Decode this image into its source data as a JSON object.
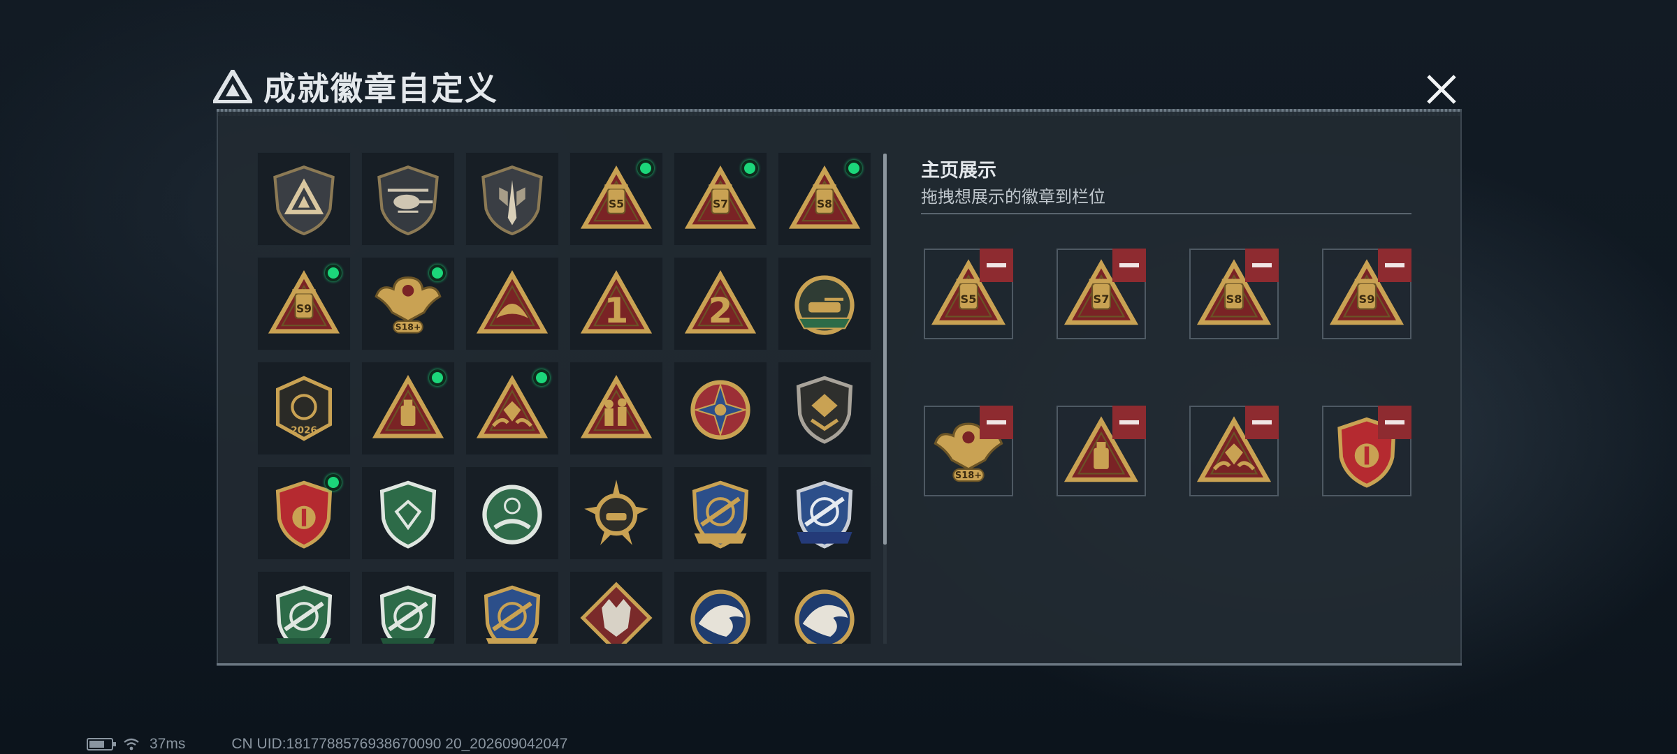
{
  "window": {
    "title": "成就徽章自定义",
    "close_label": "close"
  },
  "showcase": {
    "title": "主页展示",
    "subtitle": "拖拽想展示的徽章到栏位"
  },
  "badges": [
    {
      "icon": "delta-shield-icon",
      "equipped": false
    },
    {
      "icon": "helicopter-shield-icon",
      "equipped": false
    },
    {
      "icon": "dagger-shield-icon",
      "equipped": false
    },
    {
      "icon": "s5-season-badge-icon",
      "label": "S5",
      "equipped": true
    },
    {
      "icon": "s7-season-badge-icon",
      "label": "S7",
      "equipped": true
    },
    {
      "icon": "s8-season-badge-icon",
      "label": "S8",
      "equipped": true
    },
    {
      "icon": "s9-season-badge-icon",
      "label": "S9",
      "equipped": true
    },
    {
      "icon": "s18-eagle-badge-icon",
      "label": "S18+",
      "equipped": true
    },
    {
      "icon": "bird-triangle-badge-icon",
      "equipped": false
    },
    {
      "icon": "rank-1-badge-icon",
      "label": "1",
      "equipped": false
    },
    {
      "icon": "rank-2-badge-icon",
      "label": "2",
      "equipped": false
    },
    {
      "icon": "delta-force-tank-badge-icon",
      "equipped": false
    },
    {
      "icon": "delta-force-2026-badge-icon",
      "label": "2026",
      "equipped": false
    },
    {
      "icon": "usb-triangle-badge-icon",
      "equipped": true
    },
    {
      "icon": "gem-hands-badge-icon",
      "equipped": true
    },
    {
      "icon": "soldiers-triangle-badge-icon",
      "equipped": false
    },
    {
      "icon": "star-compass-badge-icon",
      "equipped": false
    },
    {
      "icon": "chevron-shield-badge-icon",
      "equipped": false
    },
    {
      "icon": "crest-shield-badge-icon",
      "equipped": true
    },
    {
      "icon": "green-gem-shield-badge-icon",
      "equipped": false
    },
    {
      "icon": "green-target-badge-icon",
      "equipped": false
    },
    {
      "icon": "tank-star-badge-icon",
      "equipped": false
    },
    {
      "icon": "gold-rifle-shield-badge-icon",
      "equipped": false
    },
    {
      "icon": "blue-rifle-shield-badge-icon",
      "equipped": false
    },
    {
      "icon": "green-rifle-shield-badge-icon",
      "equipped": false
    },
    {
      "icon": "green-rifle-shield-2-badge-icon",
      "equipped": false
    },
    {
      "icon": "gold-rifle-shield-2-badge-icon",
      "equipped": false
    },
    {
      "icon": "wolf-diamond-badge-icon",
      "equipped": false
    },
    {
      "icon": "eagle-blue-badge-icon",
      "equipped": false
    },
    {
      "icon": "eagle-blue-2-badge-icon",
      "equipped": false
    }
  ],
  "slots": [
    {
      "icon": "s5-season-badge-icon",
      "label": "S5"
    },
    {
      "icon": "s7-season-badge-icon",
      "label": "S7"
    },
    {
      "icon": "s8-season-badge-icon",
      "label": "S8"
    },
    {
      "icon": "s9-season-badge-icon",
      "label": "S9"
    },
    {
      "icon": "s18-eagle-badge-icon",
      "label": "S18+"
    },
    {
      "icon": "usb-triangle-badge-icon"
    },
    {
      "icon": "gem-hands-badge-icon"
    },
    {
      "icon": "crest-shield-badge-icon"
    }
  ],
  "status": {
    "ping": "37ms",
    "uid": "CN UID:1817788576938670090 20_202609042047",
    "battery_level": 0.7
  },
  "colors": {
    "gold": "#c9a253",
    "dark_gold": "#6b5426",
    "red": "#7a2325",
    "equipped_dot": "#1cd67a",
    "remove_button": "#8e2b30"
  }
}
